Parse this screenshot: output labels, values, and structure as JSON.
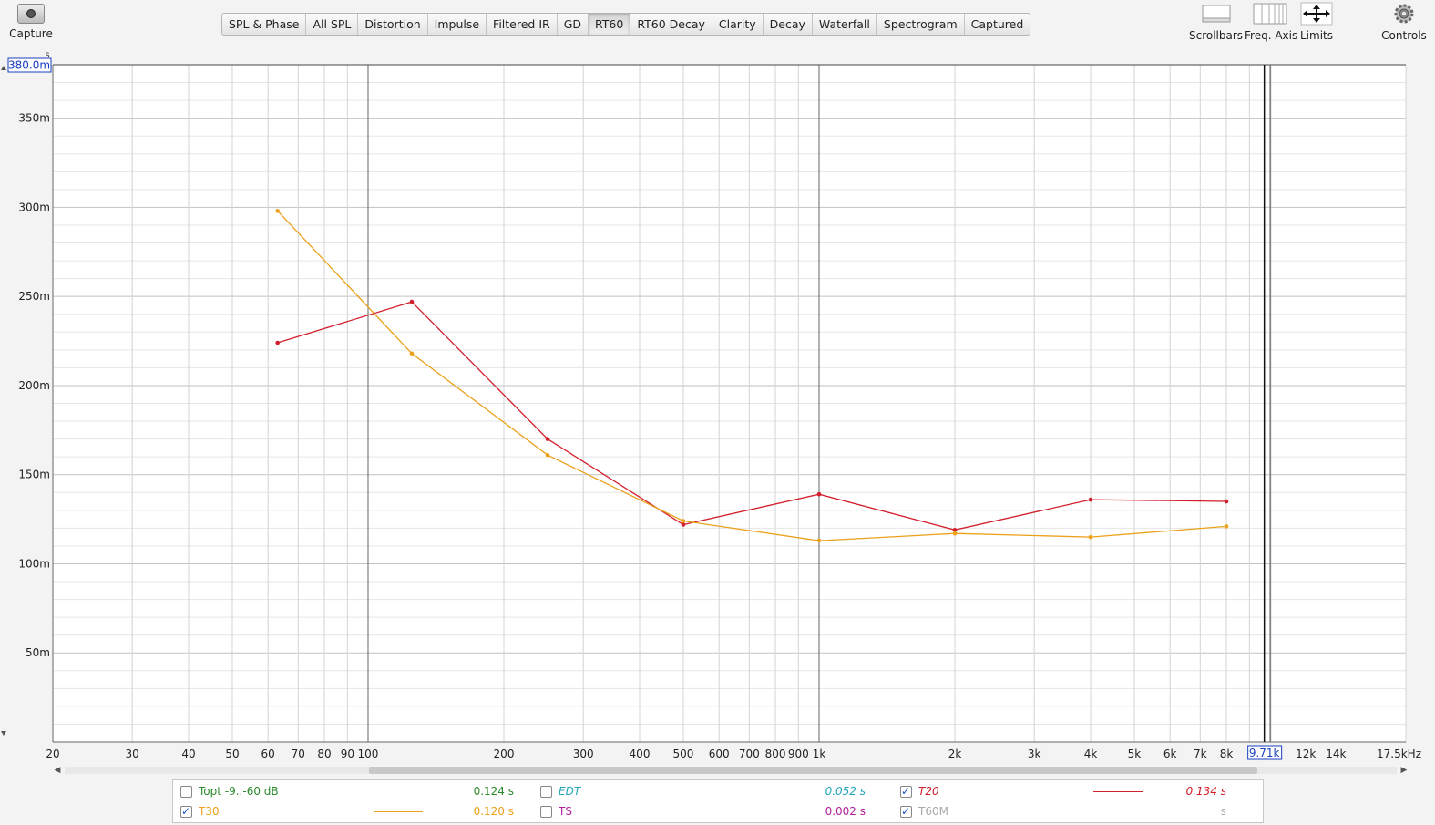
{
  "toolbar": {
    "capture_label": "Capture",
    "tabs": [
      {
        "label": "SPL & Phase",
        "active": false
      },
      {
        "label": "All SPL",
        "active": false
      },
      {
        "label": "Distortion",
        "active": false
      },
      {
        "label": "Impulse",
        "active": false
      },
      {
        "label": "Filtered IR",
        "active": false
      },
      {
        "label": "GD",
        "active": false
      },
      {
        "label": "RT60",
        "active": true
      },
      {
        "label": "RT60 Decay",
        "active": false
      },
      {
        "label": "Clarity",
        "active": false
      },
      {
        "label": "Decay",
        "active": false
      },
      {
        "label": "Waterfall",
        "active": false
      },
      {
        "label": "Spectrogram",
        "active": false
      },
      {
        "label": "Captured",
        "active": false
      }
    ],
    "scrollbars_label": "Scrollbars",
    "freq_axis_label": "Freq. Axis",
    "limits_label": "Limits",
    "controls_label": "Controls"
  },
  "plot": {
    "y_unit": "s",
    "y_top_readout": "380.0m",
    "y_tick_labels": [
      "350m",
      "300m",
      "250m",
      "200m",
      "150m",
      "100m",
      "50m"
    ],
    "y_tick_values": [
      0.35,
      0.3,
      0.25,
      0.2,
      0.15,
      0.1,
      0.05
    ],
    "x_tick_labels": [
      "20",
      "30",
      "40",
      "50",
      "60",
      "70",
      "80",
      "90",
      "100",
      "200",
      "300",
      "400",
      "500",
      "600",
      "700",
      "800",
      "900",
      "1k",
      "2k",
      "3k",
      "4k",
      "5k",
      "6k",
      "7k",
      "8k",
      "12k",
      "14k",
      "17.5kHz"
    ],
    "x_tick_values": [
      20,
      30,
      40,
      50,
      60,
      70,
      80,
      90,
      100,
      200,
      300,
      400,
      500,
      600,
      700,
      800,
      900,
      1000,
      2000,
      3000,
      4000,
      5000,
      6000,
      7000,
      8000,
      12000,
      14000,
      17500
    ],
    "cursor_readout": "9.71k",
    "cursor_value": 9710,
    "colors": {
      "grid_minor": "#d9d9d9",
      "grid_major": "#666666",
      "T20": "#d21f2c",
      "T30": "#eba11a",
      "readout": "#1a3fc0"
    }
  },
  "chart_data": {
    "type": "line",
    "x_scale": "log",
    "xlim": [
      20,
      20000
    ],
    "ylim": [
      0,
      0.38
    ],
    "grid": true,
    "x": [
      63,
      125,
      250,
      500,
      1000,
      2000,
      4000,
      8000
    ],
    "series": [
      {
        "name": "T20",
        "values": [
          0.224,
          0.247,
          0.17,
          0.122,
          0.139,
          0.119,
          0.136,
          0.135
        ]
      },
      {
        "name": "T30",
        "values": [
          0.298,
          0.218,
          0.161,
          0.124,
          0.113,
          0.117,
          0.115,
          0.121
        ]
      }
    ]
  },
  "legend": {
    "topt": {
      "label": "Topt -9..-60 dB",
      "value": "0.124 s",
      "checked": false,
      "color": "#2d8a2d"
    },
    "t30": {
      "label": "T30",
      "value": "0.120 s",
      "checked": true,
      "color": "#eba11a"
    },
    "edt": {
      "label": "EDT",
      "value": "0.052 s",
      "checked": false,
      "color": "#23a6b8"
    },
    "ts": {
      "label": "TS",
      "value": "0.002 s",
      "checked": false,
      "color": "#b0209a"
    },
    "t20": {
      "label": "T20",
      "value": "0.134 s",
      "checked": true,
      "color": "#d21f2c"
    },
    "t60m": {
      "label": "T60M",
      "value": "s",
      "checked": true,
      "color": "#aaaaaa"
    }
  }
}
